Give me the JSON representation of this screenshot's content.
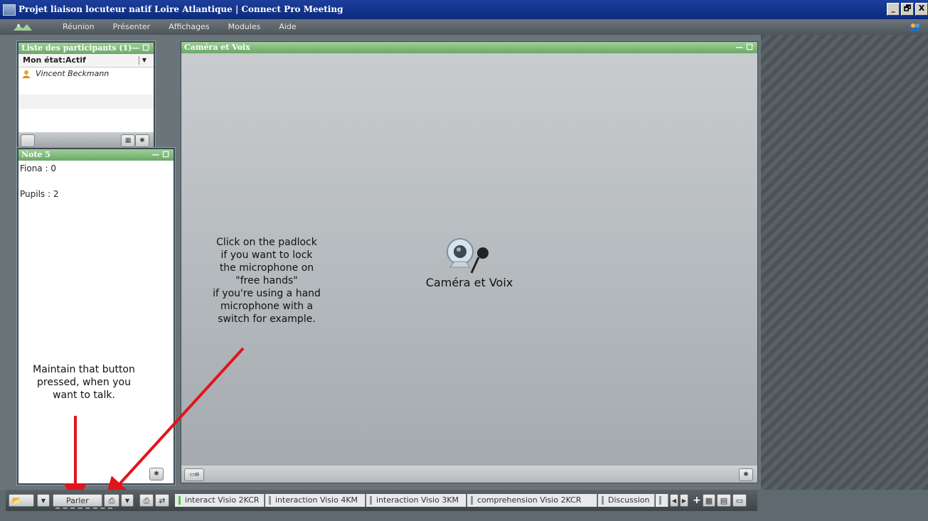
{
  "window": {
    "title": "Projet liaison locuteur natif Loire Atlantique | Connect Pro Meeting",
    "min": "_",
    "restore": "🗗",
    "close": "X"
  },
  "menu": [
    "Réunion",
    "Présenter",
    "Affichages",
    "Modules",
    "Aide"
  ],
  "participants": {
    "title": "Liste des participants (1)",
    "status": "Mon état:Actif",
    "people": [
      "Vincent Beckmann"
    ]
  },
  "note": {
    "title": "Note 5",
    "text": "Fiona : 0\n\nPupils : 2"
  },
  "camera": {
    "title": "Caméra et Voix",
    "label": "Caméra et Voix"
  },
  "annotations": {
    "padlock": "Click on the padlock\nif you want to lock\nthe microphone on\n\"free hands\"\nif you're using a hand\nmicrophone with a\nswitch for example.",
    "talk": "Maintain that button\npressed, when you\nwant to talk."
  },
  "taskbar": {
    "talk_label": "Parler",
    "tabs": [
      "interact Visio 2KCR",
      "interaction Visio 4KM",
      "interaction Visio 3KM",
      "comprehension Visio 2KCR",
      "Discussion"
    ]
  },
  "colors": {
    "pod_header": "#7cb877",
    "title_bar": "#0e2f86",
    "arrow": "#e2141c"
  }
}
